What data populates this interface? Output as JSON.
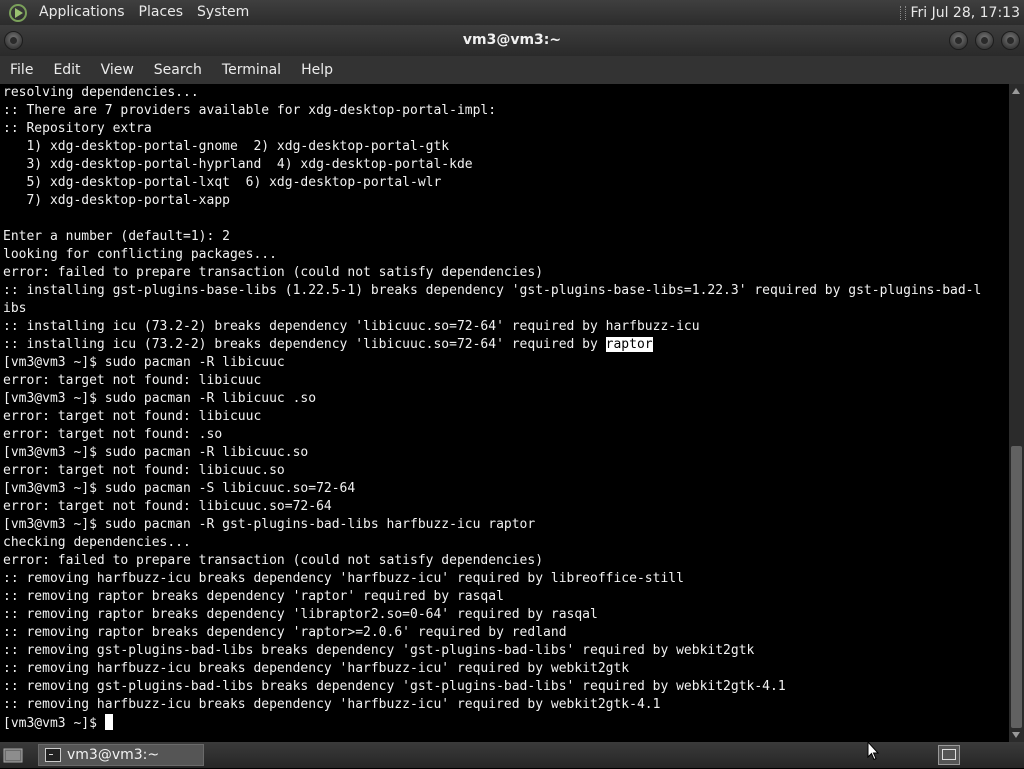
{
  "top_panel": {
    "menus": [
      "Applications",
      "Places",
      "System"
    ],
    "clock": "Fri Jul 28, 17:13"
  },
  "window": {
    "title": "vm3@vm3:~"
  },
  "menubar": {
    "items": [
      "File",
      "Edit",
      "View",
      "Search",
      "Terminal",
      "Help"
    ]
  },
  "terminal": {
    "lines": [
      "resolving dependencies...",
      ":: There are 7 providers available for xdg-desktop-portal-impl:",
      ":: Repository extra",
      "   1) xdg-desktop-portal-gnome  2) xdg-desktop-portal-gtk",
      "   3) xdg-desktop-portal-hyprland  4) xdg-desktop-portal-kde",
      "   5) xdg-desktop-portal-lxqt  6) xdg-desktop-portal-wlr",
      "   7) xdg-desktop-portal-xapp",
      "",
      "Enter a number (default=1): 2",
      "looking for conflicting packages...",
      "error: failed to prepare transaction (could not satisfy dependencies)",
      ":: installing gst-plugins-base-libs (1.22.5-1) breaks dependency 'gst-plugins-base-libs=1.22.3' required by gst-plugins-bad-l",
      "ibs",
      ":: installing icu (73.2-2) breaks dependency 'libicuuc.so=72-64' required by harfbuzz-icu",
      ":: installing icu (73.2-2) breaks dependency 'libicuuc.so=72-64' required by ",
      "[vm3@vm3 ~]$ sudo pacman -R libicuuc",
      "error: target not found: libicuuc",
      "[vm3@vm3 ~]$ sudo pacman -R libicuuc .so",
      "error: target not found: libicuuc",
      "error: target not found: .so",
      "[vm3@vm3 ~]$ sudo pacman -R libicuuc.so",
      "error: target not found: libicuuc.so",
      "[vm3@vm3 ~]$ sudo pacman -S libicuuc.so=72-64",
      "error: target not found: libicuuc.so=72-64",
      "[vm3@vm3 ~]$ sudo pacman -R gst-plugins-bad-libs harfbuzz-icu raptor",
      "checking dependencies...",
      "error: failed to prepare transaction (could not satisfy dependencies)",
      ":: removing harfbuzz-icu breaks dependency 'harfbuzz-icu' required by libreoffice-still",
      ":: removing raptor breaks dependency 'raptor' required by rasqal",
      ":: removing raptor breaks dependency 'libraptor2.so=0-64' required by rasqal",
      ":: removing raptor breaks dependency 'raptor>=2.0.6' required by redland",
      ":: removing gst-plugins-bad-libs breaks dependency 'gst-plugins-bad-libs' required by webkit2gtk",
      ":: removing harfbuzz-icu breaks dependency 'harfbuzz-icu' required by webkit2gtk",
      ":: removing gst-plugins-bad-libs breaks dependency 'gst-plugins-bad-libs' required by webkit2gtk-4.1",
      ":: removing harfbuzz-icu breaks dependency 'harfbuzz-icu' required by webkit2gtk-4.1"
    ],
    "highlighted_word": "raptor",
    "highlight_line_index": 14,
    "prompt": "[vm3@vm3 ~]$ "
  },
  "taskbar": {
    "window_button": "vm3@vm3:~"
  },
  "colors": {
    "terminal_bg": "#000000",
    "terminal_fg": "#f2f2f2",
    "panel_bg": "#333333"
  }
}
